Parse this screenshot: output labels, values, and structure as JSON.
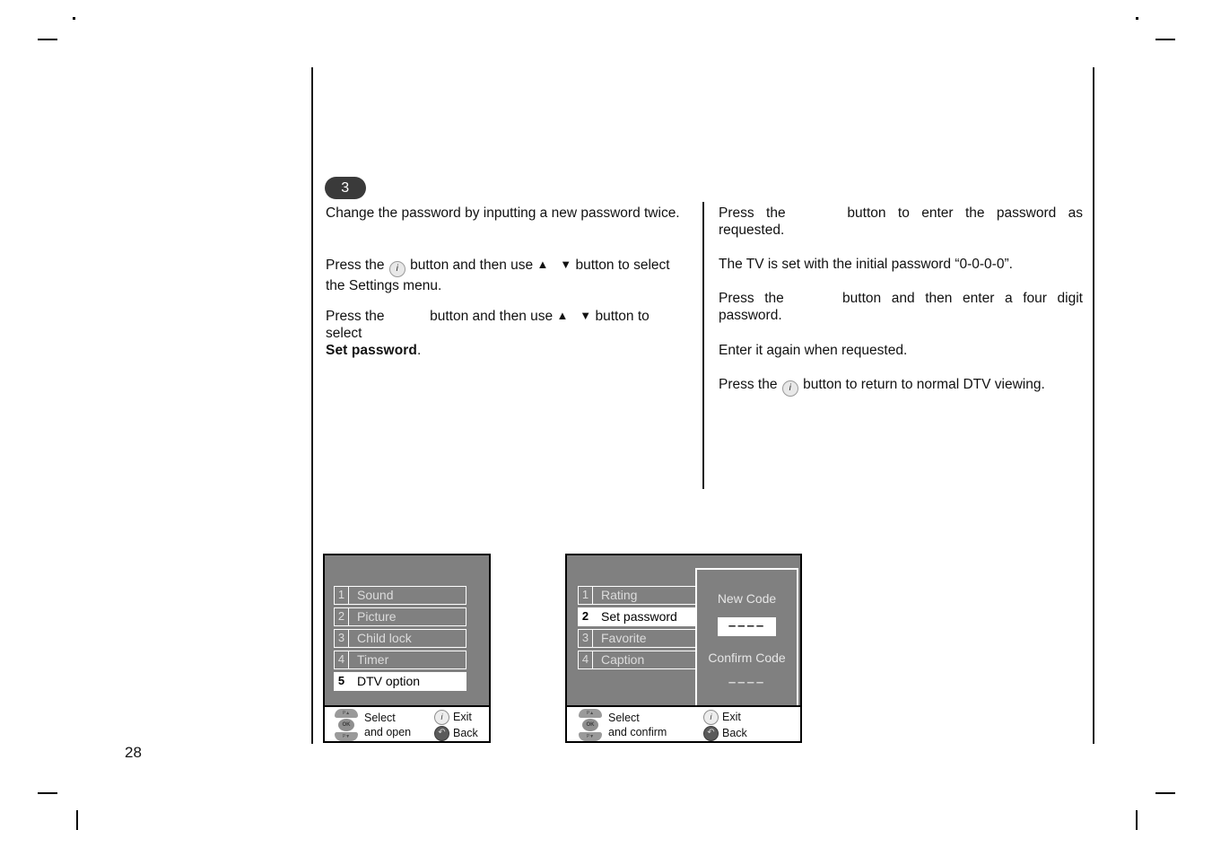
{
  "page": {
    "number": "28"
  },
  "step": {
    "badge": "3"
  },
  "left_column": {
    "p1": "Change the password by inputting a new password twice.",
    "p2_before": "Press the",
    "p2_mid": "button and then use",
    "p2_after": "button to select the Settings menu.",
    "p3_before": "Press the",
    "p3_mid": "button and then use",
    "p3_after": "button to select",
    "p3_bold": "Set password",
    "p3_end": "."
  },
  "right_column": {
    "p1_before": "Press the",
    "p1_after": "button to enter the password as requested.",
    "p2": "The TV is set with the initial password “0-0-0-0”.",
    "p3_before": "Press the",
    "p3_after": "button and then enter a four digit password.",
    "p4": "Enter it again when requested.",
    "p5_before": "Press the",
    "p5_after": "button to return to normal DTV viewing."
  },
  "osd_left": {
    "items": [
      {
        "num": "1",
        "label": "Sound",
        "selected": false
      },
      {
        "num": "2",
        "label": "Picture",
        "selected": false
      },
      {
        "num": "3",
        "label": "Child lock",
        "selected": false
      },
      {
        "num": "4",
        "label": "Timer",
        "selected": false
      },
      {
        "num": "5",
        "label": "DTV option",
        "selected": true
      }
    ],
    "footer": {
      "select_line1": "Select",
      "select_line2": "and open",
      "exit": "Exit",
      "back": "Back",
      "dpad_top": "P▲",
      "dpad_ok": "OK",
      "dpad_bottom": "P▼",
      "info_glyph": "i",
      "back_glyph": "↶"
    }
  },
  "osd_right": {
    "items": [
      {
        "num": "1",
        "label": "Rating",
        "selected": false
      },
      {
        "num": "2",
        "label": "Set password",
        "selected": true
      },
      {
        "num": "3",
        "label": "Favorite",
        "selected": false
      },
      {
        "num": "4",
        "label": "Caption",
        "selected": false
      }
    ],
    "code_panel": {
      "new_code_label": "New Code",
      "new_code_value": "––––",
      "confirm_code_label": "Confirm Code",
      "confirm_code_value": "––––"
    },
    "footer": {
      "select_line1": "Select",
      "select_line2": "and confirm",
      "exit": "Exit",
      "back": "Back",
      "dpad_top": "P▲",
      "dpad_ok": "OK",
      "dpad_bottom": "P▼",
      "info_glyph": "i",
      "back_glyph": "↶"
    }
  },
  "glyphs": {
    "info": "i",
    "arrow_up": "▲",
    "arrow_down": "▼"
  },
  "colors": {
    "osd_background": "#808080",
    "osd_border": "#000000",
    "osd_text": "#dcdcdc",
    "osd_selected_bg": "#ffffff",
    "osd_selected_text": "#000000",
    "badge_bg": "#3a3a3a",
    "page_rule": "#1a1a1a"
  }
}
